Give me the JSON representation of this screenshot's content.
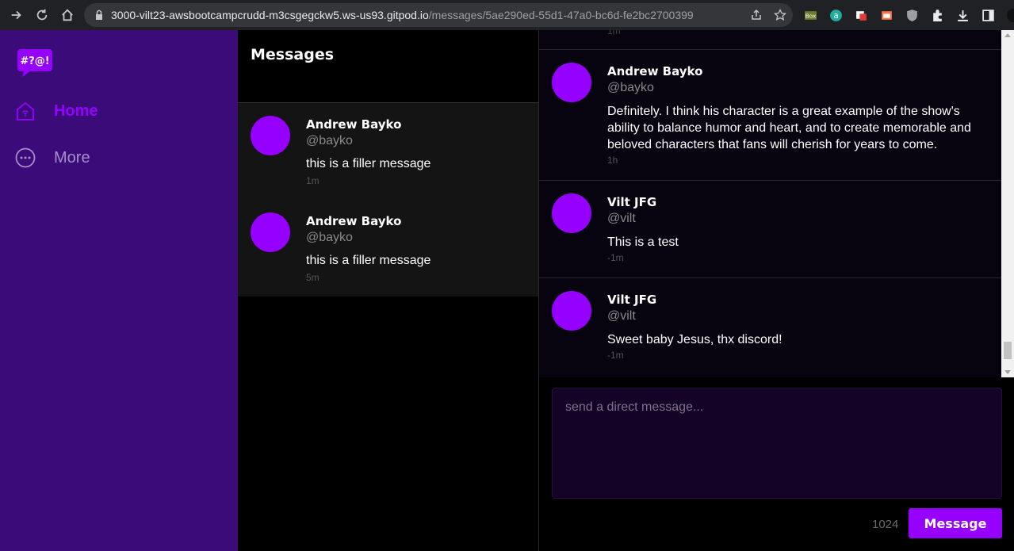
{
  "browser": {
    "url_host": "3000-vilt23-awsbootcampcrudd-m3csgegckw5.ws-us93.gitpod.io",
    "url_path": "/messages/5ae290ed-55d1-47a0-bc6d-fe2bc2700399",
    "extension_icons": [
      "box-icon",
      "a-extension-icon",
      "extension-icon",
      "extension-icon",
      "shield-icon",
      "puzzle-icon",
      "download-icon",
      "sidepanel-icon",
      "profile-icon"
    ]
  },
  "app": {
    "brand_colors": {
      "sidebar": "#3b0b7a",
      "accent": "#9500ff"
    },
    "logo_text": "#?@!",
    "nav": [
      {
        "label": "Home",
        "icon": "home-icon",
        "active": true
      },
      {
        "label": "More",
        "icon": "more-icon",
        "active": false
      }
    ]
  },
  "groups": {
    "title": "Messages",
    "items": [
      {
        "name": "Andrew Bayko",
        "handle": "@bayko",
        "message": "this is a filler message",
        "time": "1m"
      },
      {
        "name": "Andrew Bayko",
        "handle": "@bayko",
        "message": "this is a filler message",
        "time": "5m"
      }
    ]
  },
  "conversation": {
    "partial_top_time": "1m",
    "messages": [
      {
        "name": "Andrew Bayko",
        "handle": "@bayko",
        "body": "Definitely. I think his character is a great example of the show's ability to balance humor and heart, and to create memorable and beloved characters that fans will cherish for years to come.",
        "time": "1h"
      },
      {
        "name": "Vilt JFG",
        "handle": "@vilt",
        "body": "This is a test",
        "time": "-1m"
      },
      {
        "name": "Vilt JFG",
        "handle": "@vilt",
        "body": "Sweet baby Jesus, thx discord!",
        "time": "-1m"
      }
    ]
  },
  "composer": {
    "placeholder": "send a direct message...",
    "value": "",
    "count": "1024",
    "send_label": "Message"
  }
}
